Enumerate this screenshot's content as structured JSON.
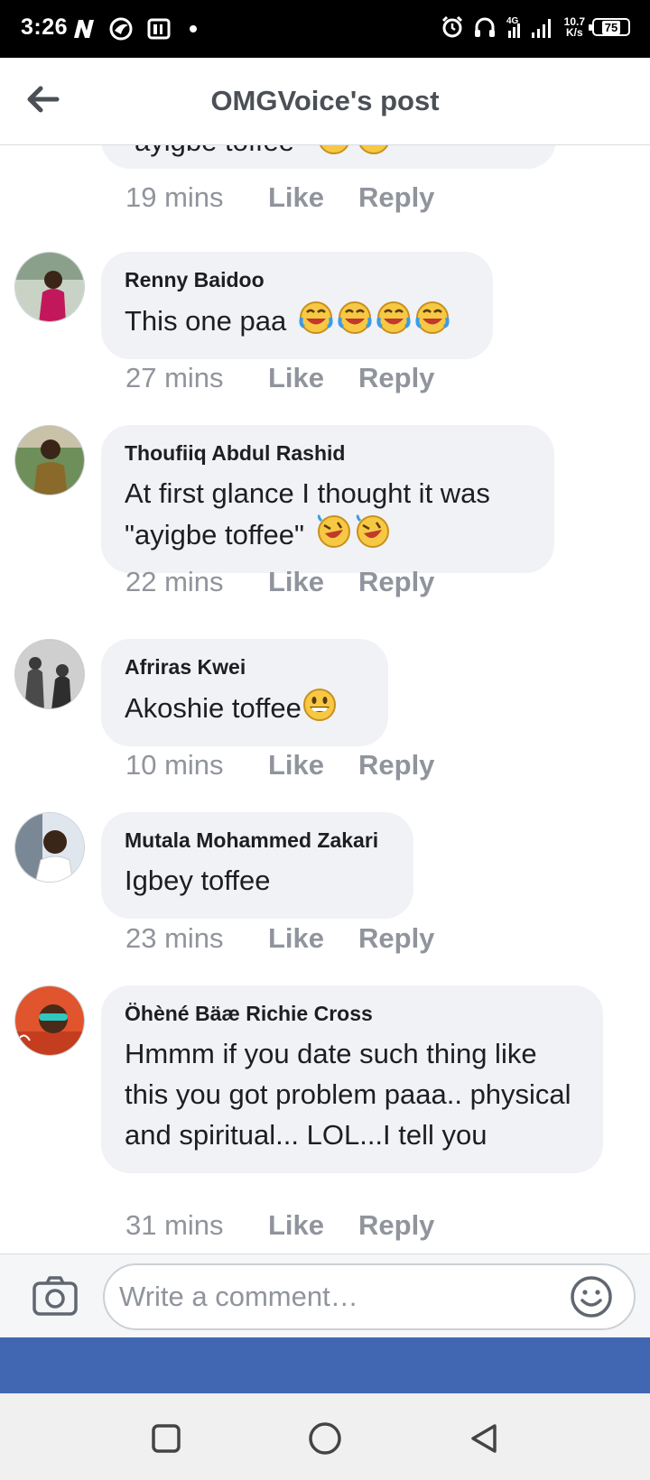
{
  "status_bar": {
    "time": "3:26",
    "network_type": "4G",
    "speed_value": "10.7",
    "speed_unit": "K/s",
    "battery": "75"
  },
  "header": {
    "title": "OMGVoice's post",
    "back_icon": "arrow-left-icon"
  },
  "partial_comment": {
    "text": "\"ayigbe toffee\"",
    "time": "19 mins",
    "like": "Like",
    "reply": "Reply"
  },
  "comments": [
    {
      "author": "Renny Baidoo",
      "text": "This one paa",
      "time": "27 mins",
      "like": "Like",
      "reply": "Reply",
      "emoji": "tears-of-joy-emoji",
      "emoji_count": 4
    },
    {
      "author": "Thoufiiq Abdul Rashid",
      "text": "At first glance I thought it was \"ayigbe toffee\"",
      "time": "22 mins",
      "like": "Like",
      "reply": "Reply",
      "emoji": "rofl-emoji",
      "emoji_count": 2
    },
    {
      "author": "Afriras Kwei",
      "text": "Akoshie toffee",
      "time": "10 mins",
      "like": "Like",
      "reply": "Reply",
      "emoji": "grinning-emoji",
      "emoji_count": 1
    },
    {
      "author": "Mutala Mohammed Zakari",
      "text": "Igbey toffee",
      "time": "23 mins",
      "like": "Like",
      "reply": "Reply"
    },
    {
      "author": "Öhèné Bäæ Richie Cross",
      "text": "Hmmm if you date such thing like this you got problem paaa.. physical and spiritual... LOL...I tell you",
      "time": "31 mins",
      "like": "Like",
      "reply": "Reply"
    }
  ],
  "composer": {
    "placeholder": "Write a comment…",
    "camera_icon": "camera-icon",
    "emoji_icon": "smiley-icon"
  },
  "colors": {
    "accent": "#4267b2",
    "bubble": "#f0f2f5",
    "meta": "#90949c"
  }
}
